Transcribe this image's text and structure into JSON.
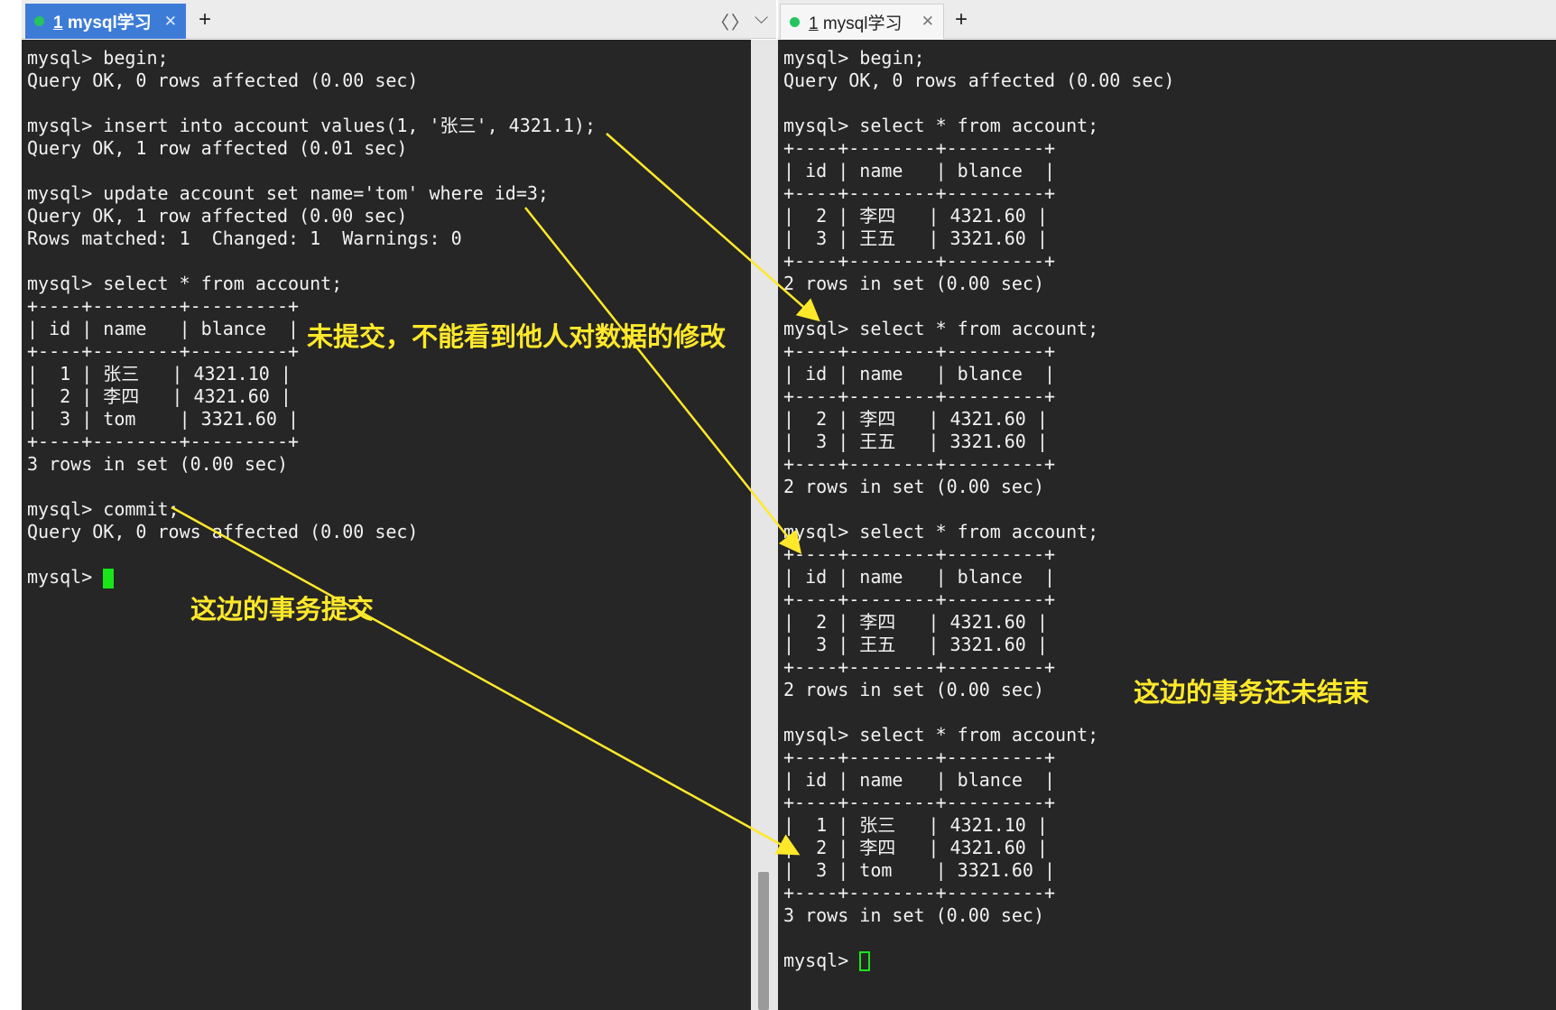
{
  "left_tab": {
    "label_number": "1",
    "label_text": "mysql学习",
    "close": "✕",
    "new_tab": "+"
  },
  "right_tab": {
    "label_number": "1",
    "label_text": "mysql学习",
    "close": "✕",
    "new_tab": "+"
  },
  "tab_nav": {
    "prev": "〈",
    "next": "〉",
    "menu": "⌵"
  },
  "left_terminal": {
    "lines": [
      "mysql> begin;",
      "Query OK, 0 rows affected (0.00 sec)",
      "",
      "mysql> insert into account values(1, '张三', 4321.1);",
      "Query OK, 1 row affected (0.01 sec)",
      "",
      "mysql> update account set name='tom' where id=3;",
      "Query OK, 1 row affected (0.00 sec)",
      "Rows matched: 1  Changed: 1  Warnings: 0",
      "",
      "mysql> select * from account;",
      "+----+--------+---------+",
      "| id | name   | blance  |",
      "+----+--------+---------+",
      "|  1 | 张三   | 4321.10 |",
      "|  2 | 李四   | 4321.60 |",
      "|  3 | tom    | 3321.60 |",
      "+----+--------+---------+",
      "3 rows in set (0.00 sec)",
      "",
      "mysql> commit;",
      "Query OK, 0 rows affected (0.00 sec)",
      "",
      "mysql> "
    ]
  },
  "right_terminal": {
    "lines": [
      "mysql> begin;",
      "Query OK, 0 rows affected (0.00 sec)",
      "",
      "mysql> select * from account;",
      "+----+--------+---------+",
      "| id | name   | blance  |",
      "+----+--------+---------+",
      "|  2 | 李四   | 4321.60 |",
      "|  3 | 王五   | 3321.60 |",
      "+----+--------+---------+",
      "2 rows in set (0.00 sec)",
      "",
      "mysql> select * from account;",
      "+----+--------+---------+",
      "| id | name   | blance  |",
      "+----+--------+---------+",
      "|  2 | 李四   | 4321.60 |",
      "|  3 | 王五   | 3321.60 |",
      "+----+--------+---------+",
      "2 rows in set (0.00 sec)",
      "",
      "mysql> select * from account;",
      "+----+--------+---------+",
      "| id | name   | blance  |",
      "+----+--------+---------+",
      "|  2 | 李四   | 4321.60 |",
      "|  3 | 王五   | 3321.60 |",
      "+----+--------+---------+",
      "2 rows in set (0.00 sec)",
      "",
      "mysql> select * from account;",
      "+----+--------+---------+",
      "| id | name   | blance  |",
      "+----+--------+---------+",
      "|  1 | 张三   | 4321.10 |",
      "|  2 | 李四   | 4321.60 |",
      "|  3 | tom    | 3321.60 |",
      "+----+--------+---------+",
      "3 rows in set (0.00 sec)",
      "",
      "mysql> "
    ]
  },
  "annotations": {
    "uncommitted": "未提交，不能看到他人对数据的修改",
    "committed_here": "这边的事务提交",
    "not_finished": "这边的事务还未结束"
  },
  "colors": {
    "terminal_bg": "#262626",
    "terminal_fg": "#f2f2f2",
    "cursor": "#19e619",
    "annotation": "#ffe82a",
    "active_tab": "#3d7cd6",
    "status_dot": "#22c55e"
  }
}
